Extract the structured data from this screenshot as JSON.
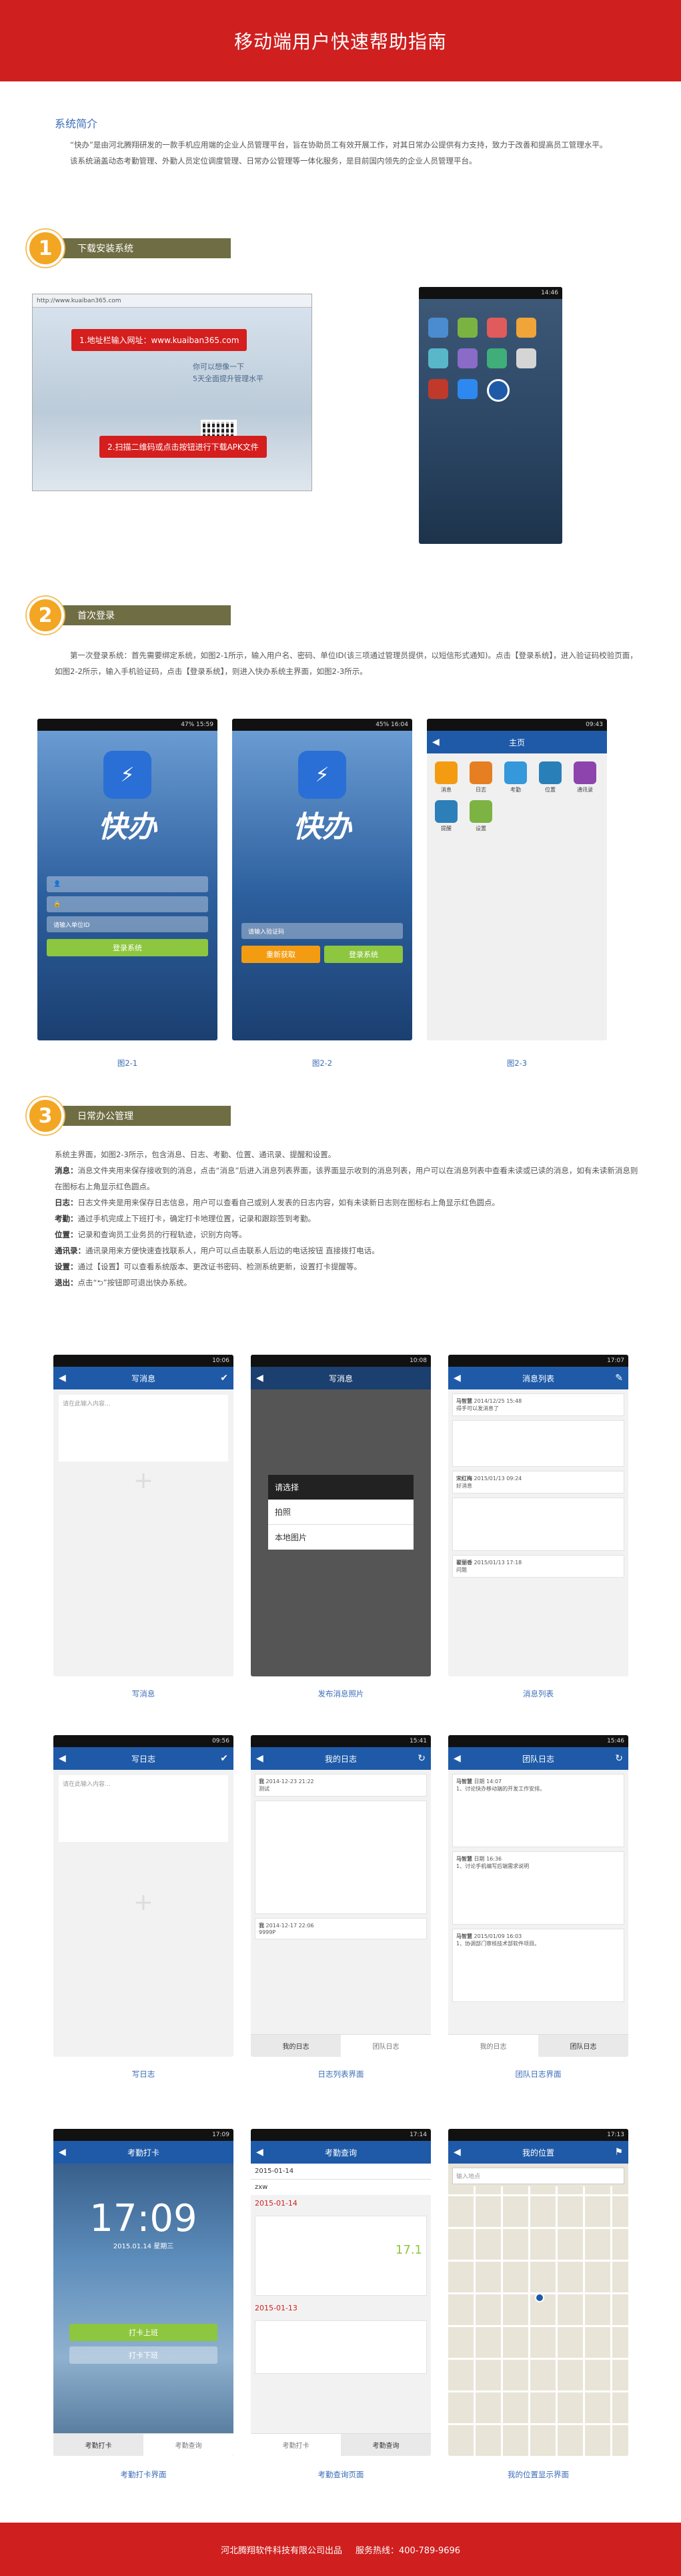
{
  "header": {
    "title": "移动端用户快速帮助指南"
  },
  "intro": {
    "title": "系统简介",
    "p1": "“快办”是由河北腾翔研发的一款手机应用端的企业人员管理平台，旨在协助员工有效开展工作，对其日常办公提供有力支持，致力于改善和提高员工管理水平。",
    "p2": "该系统涵盖动态考勤管理、外勤人员定位调度管理、日常办公管理等一体化服务，是目前国内领先的企业人员管理平台。"
  },
  "sections": [
    {
      "num": "1",
      "title": "下载安装系统"
    },
    {
      "num": "2",
      "title": "首次登录"
    },
    {
      "num": "3",
      "title": "日常办公管理"
    }
  ],
  "download": {
    "step1": "1.地址栏输入网址：www.kuaiban365.com",
    "step2": "2.扫描二维码或点击按钮进行下载APK文件",
    "browser_url": "http://www.kuaiban365.com",
    "banner1": "你可以想像一下",
    "banner2": "5天全面提升管理水平"
  },
  "login": {
    "desc": "第一次登录系统：首先需要绑定系统，如图2-1所示，输入用户名、密码、单位ID(该三项通过管理员提供，以短信形式通知)。点击【登录系统】，进入验证码校验页面，如图2-2所示，输入手机验证码，点击【登录系统】，则进入快办系统主界面，如图2-3所示。",
    "brand": "快办",
    "unit_placeholder": "请输入单位ID",
    "code_placeholder": "请输入验证码",
    "login_btn": "登录系统",
    "resend_btn": "重新获取",
    "main_title": "主页",
    "menu": [
      "消息",
      "日志",
      "考勤",
      "位置",
      "通讯录",
      "提醒",
      "设置"
    ],
    "captions": [
      "图2-1",
      "图2-2",
      "图2-3"
    ]
  },
  "daily": {
    "lines": [
      {
        "k": "",
        "v": "系统主界面，如图2-3所示，包含消息、日志、考勤、位置、通讯录、提醒和设置。"
      },
      {
        "k": "消息：",
        "v": "消息文件夹用来保存接收到的消息，点击“消息”后进入消息列表界面，该界面显示收到的消息列表，用户可以在消息列表中查看未读或已读的消息，如有未读新消息则在图标右上角显示红色圆点。"
      },
      {
        "k": "日志：",
        "v": "日志文件夹是用来保存日志信息，用户可以查看自己或别人发表的日志内容，如有未读新日志则在图标右上角显示红色圆点。"
      },
      {
        "k": "考勤：",
        "v": "通过手机完成上下班打卡，确定打卡地理位置，记录和跟踪签到考勤。"
      },
      {
        "k": "位置：",
        "v": "记录和查询员工业务员的行程轨迹，识别方向等。"
      },
      {
        "k": "通讯录：",
        "v": "通讯录用来方便快速查找联系人，用户可以点击联系人后边的电话按钮 直接拨打电话。"
      },
      {
        "k": "设置：",
        "v": "通过【设置】可以查看系统版本、更改证书密码、检测系统更新，设置打卡提醒等。"
      },
      {
        "k": "退出：",
        "v": "点击“⮌”按钮即可退出快办系统。"
      }
    ]
  },
  "screens_row1": {
    "titles": [
      "写消息",
      "",
      "消息列表"
    ],
    "captions": [
      "写消息",
      "发布消息照片",
      "消息列表"
    ],
    "input_placeholder": "请在此输入内容...",
    "popup": [
      "请选择",
      "拍照",
      "本地图片"
    ],
    "msg_items": [
      {
        "name": "马智慧",
        "time": "2014/12/25 15:48",
        "text": "得手可以发消息了"
      },
      {
        "name": "宋红梅",
        "time": "2015/01/13 09:24",
        "text": "好消息"
      },
      {
        "name": "翟丽香",
        "time": "2015/01/13 17:18",
        "text": "问题"
      }
    ]
  },
  "screens_row2": {
    "titles": [
      "写日志",
      "我的日志",
      "团队日志"
    ],
    "captions": [
      "写日志",
      "日志列表界面",
      "团队日志界面"
    ],
    "log_items": [
      {
        "name": "我",
        "time": "2014-12-23 21:22",
        "text": "测试"
      },
      {
        "name": "我",
        "time": "2014-12-17 22:06",
        "text": "9999P"
      }
    ],
    "team_items": [
      {
        "name": "马智慧",
        "time": "日期 14:07",
        "text": "1、讨论快办移动端的开发工作安排。"
      },
      {
        "name": "马智慧",
        "time": "日期 16:36",
        "text": "1、讨论手机编写后端需求说明"
      },
      {
        "name": "马智慧",
        "time": "2015/01/09 16:03",
        "text": "1、协调部门审核技术部软件项目。"
      }
    ],
    "tabs": [
      "我的日志",
      "团队日志"
    ]
  },
  "screens_row3": {
    "titles": [
      "考勤打卡",
      "考勤查询",
      "我的位置"
    ],
    "captions": [
      "考勤打卡界面",
      "考勤查询页面",
      "我的位置显示界面"
    ],
    "time": "17:09",
    "date": "2015.01.14 星期三",
    "on_btn": "打卡上班",
    "off_btn": "打卡下班",
    "tabs": [
      "考勤打卡",
      "考勤查询"
    ],
    "query_date": "2015-01-14",
    "query_user": "zxw",
    "query_dates": [
      "2015-01-14",
      "2015-01-13"
    ],
    "hours": "17.1",
    "search_placeholder": "输入地点"
  },
  "footer": {
    "company": "河北腾翔软件科技有限公司出品",
    "hotline": "服务热线：400-789-9696"
  }
}
